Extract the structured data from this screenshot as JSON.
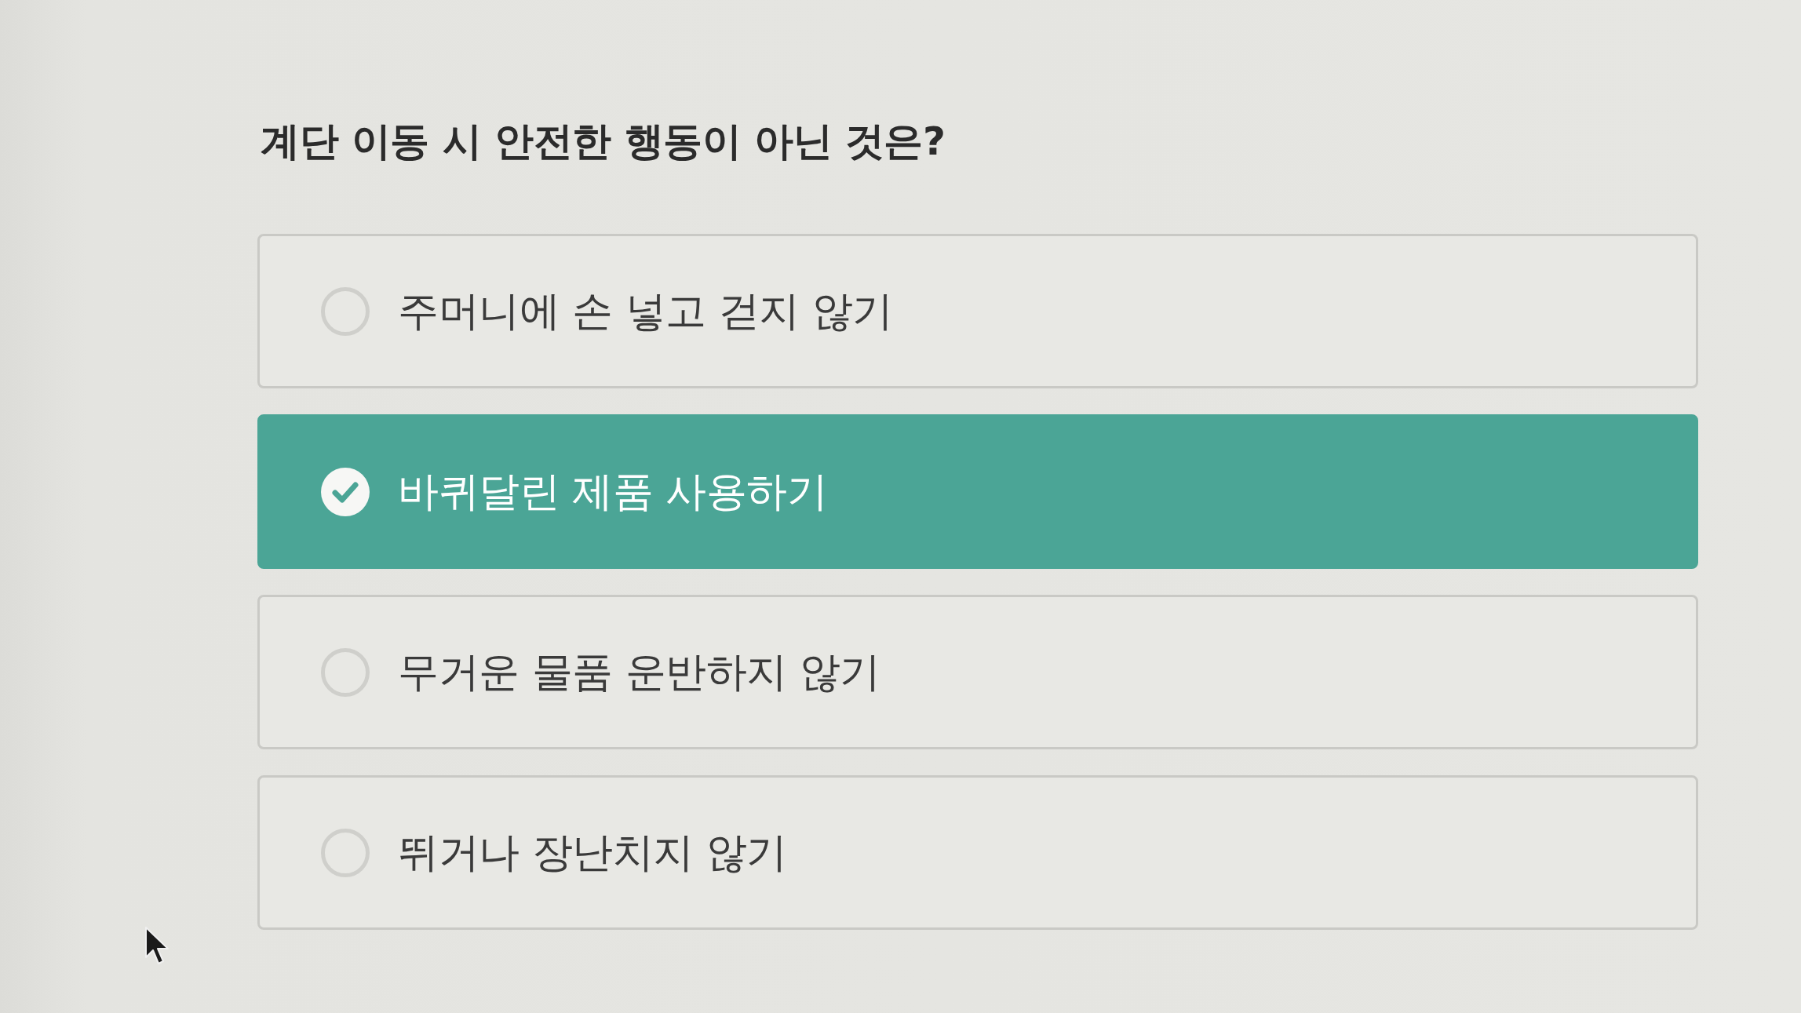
{
  "question": {
    "title": "계단 이동 시 안전한 행동이 아닌 것은?"
  },
  "options": [
    {
      "label": "주머니에 손 넣고 걷지 않기",
      "selected": false
    },
    {
      "label": "바퀴달린 제품 사용하기",
      "selected": true
    },
    {
      "label": "무거운 물품 운반하지 않기",
      "selected": false
    },
    {
      "label": "뛰거나 장난치지 않기",
      "selected": false
    }
  ]
}
